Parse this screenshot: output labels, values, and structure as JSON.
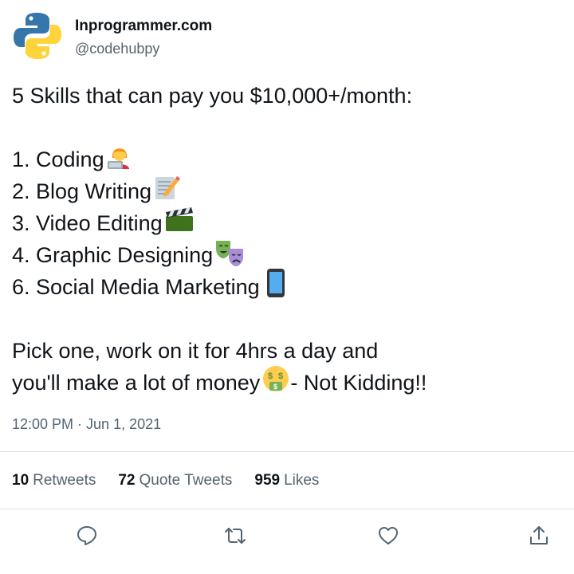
{
  "author": {
    "name": "Inprogrammer.com",
    "handle": "@codehubpy",
    "avatar_icon": "python-logo-icon"
  },
  "tweet": {
    "headline": "5 Skills that can pay you $10,000+/month:",
    "items": [
      {
        "label": "1. Coding",
        "icon": "technologist-emoji-icon"
      },
      {
        "label": "2. Blog Writing",
        "icon": "memo-emoji-icon"
      },
      {
        "label": "3. Video Editing",
        "icon": "clapper-board-emoji-icon"
      },
      {
        "label": "4. Graphic Designing",
        "icon": "performing-arts-emoji-icon"
      },
      {
        "label": "6. Social Media Marketing",
        "icon": "mobile-phone-emoji-icon"
      }
    ],
    "closing_line1": "Pick one, work on it for 4hrs a day and",
    "closing_line2_a": "you'll make a lot of money",
    "closing_line2_icon": "money-mouth-face-emoji-icon",
    "closing_line2_b": "- Not Kidding!!"
  },
  "timestamp": {
    "time": "12:00 PM",
    "separator": " · ",
    "date": "Jun 1, 2021"
  },
  "stats": {
    "retweets_count": "10",
    "retweets_label": "Retweets",
    "quotes_count": "72",
    "quotes_label": "Quote Tweets",
    "likes_count": "959",
    "likes_label": "Likes"
  },
  "actions": [
    "reply-icon",
    "retweet-icon",
    "like-icon",
    "share-icon"
  ],
  "colors": {
    "text": "#0f1419",
    "secondary": "#536471",
    "divider": "#dfe3e6"
  }
}
